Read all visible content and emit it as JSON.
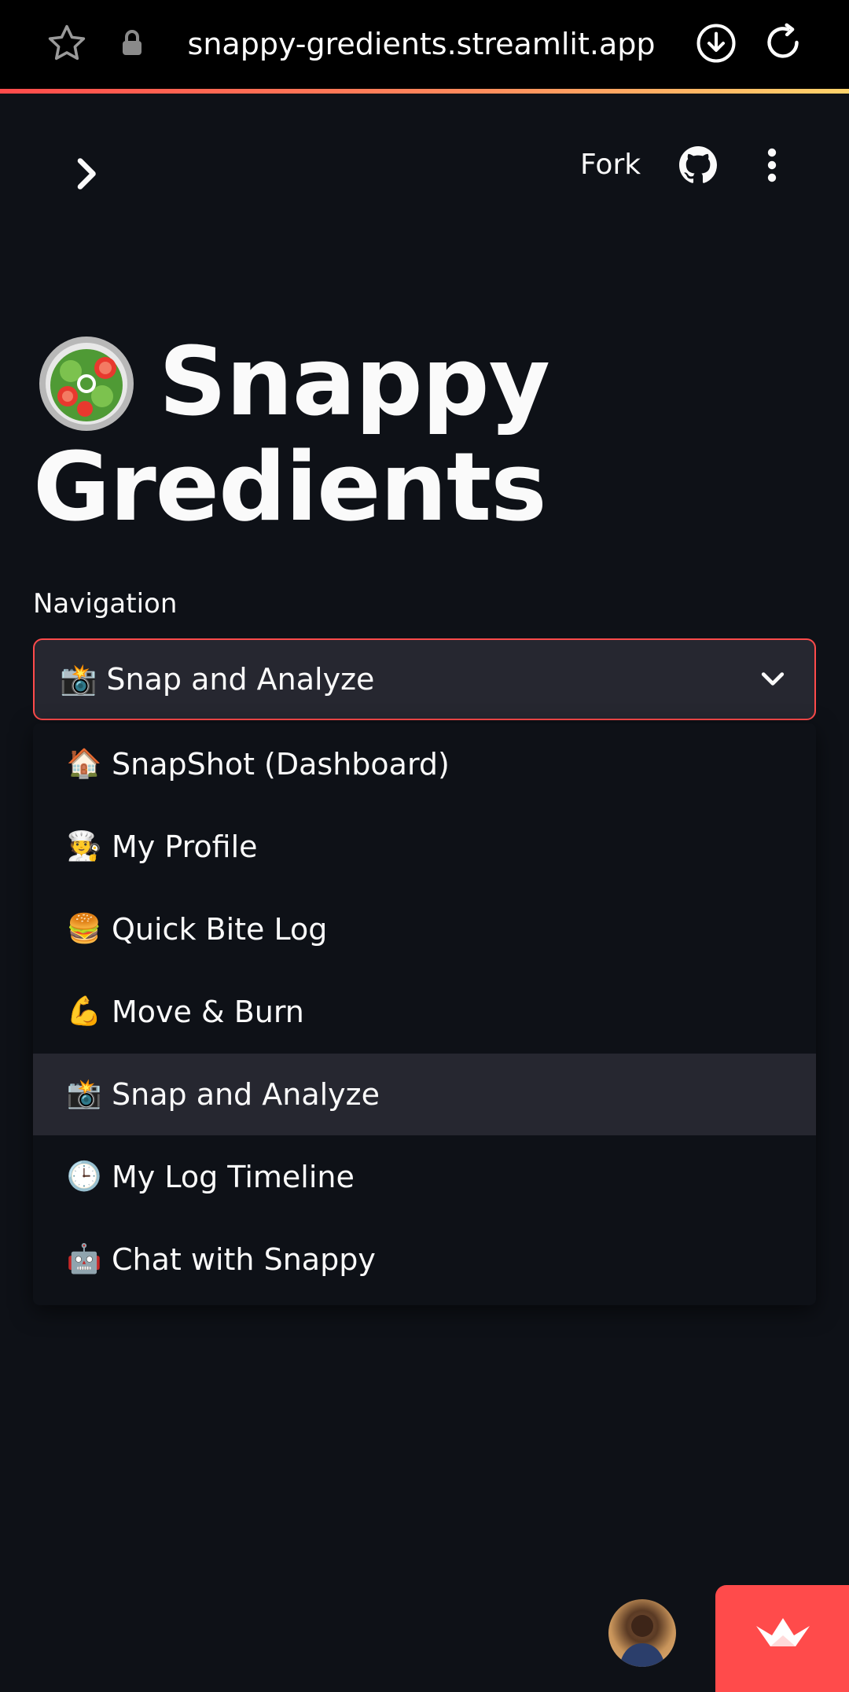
{
  "browser": {
    "url": "snappy-gredients.streamlit.app"
  },
  "header": {
    "fork_label": "Fork"
  },
  "page": {
    "title_line1": "Snappy",
    "title_line2": "Gredients",
    "title_icon": "salad-emoji"
  },
  "navigation": {
    "label": "Navigation",
    "selected_value": "📸 Snap and Analyze",
    "options": [
      {
        "icon": "🏠",
        "label": "SnapShot (Dashboard)"
      },
      {
        "icon": "🧑‍🍳",
        "label": "My Profile"
      },
      {
        "icon": "🍔",
        "label": "Quick Bite Log"
      },
      {
        "icon": "💪",
        "label": "Move & Burn"
      },
      {
        "icon": "📸",
        "label": "Snap and Analyze",
        "selected": true
      },
      {
        "icon": "🕒",
        "label": "My Log Timeline"
      },
      {
        "icon": "🤖",
        "label": "Chat with Snappy"
      }
    ]
  },
  "colors": {
    "background": "#0e1117",
    "accent": "#ff4b4b",
    "select_bg": "#262730"
  }
}
